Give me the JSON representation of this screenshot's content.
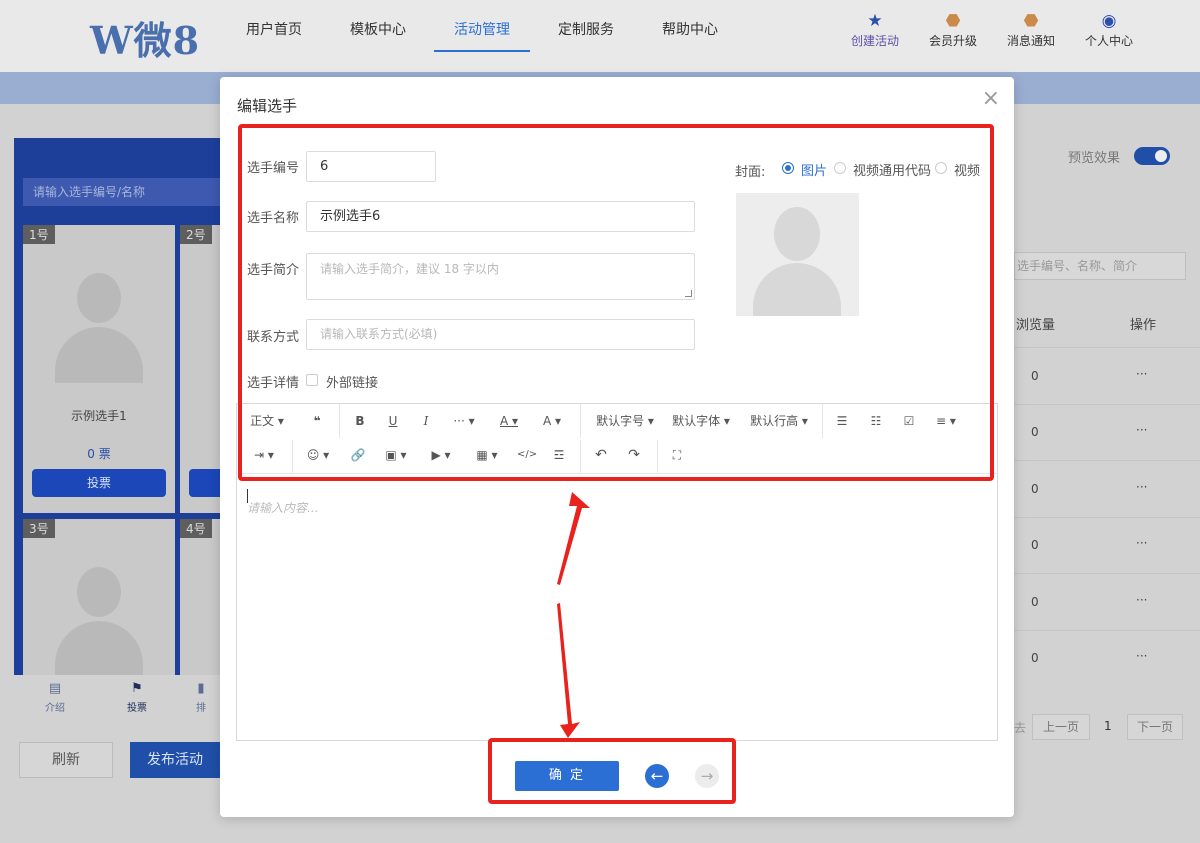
{
  "header": {
    "logo": "W微8",
    "nav": [
      {
        "label": "用户首页",
        "active": false
      },
      {
        "label": "模板中心",
        "active": false
      },
      {
        "label": "活动管理",
        "active": true
      },
      {
        "label": "定制服务",
        "active": false
      },
      {
        "label": "帮助中心",
        "active": false
      }
    ],
    "tools": [
      {
        "label": "创建活动",
        "icon": "star-icon"
      },
      {
        "label": "会员升级",
        "icon": "badge-icon"
      },
      {
        "label": "消息通知",
        "icon": "bell-icon"
      },
      {
        "label": "个人中心",
        "icon": "user-icon"
      }
    ]
  },
  "preview": {
    "search_placeholder": "请输入选手编号/名称",
    "cards": [
      {
        "num": "1号",
        "name": "示例选手1",
        "votes": "0 票",
        "vote_btn": "投票"
      },
      {
        "num": "2号"
      },
      {
        "num": "3号"
      },
      {
        "num": "4号"
      }
    ],
    "tabs": [
      {
        "label": "介绍",
        "icon": "doc-icon"
      },
      {
        "label": "投票",
        "icon": "flag-icon"
      },
      {
        "label": "排",
        "icon": "bar-chart-icon"
      }
    ],
    "refresh": "刷新",
    "publish": "发布活动"
  },
  "right_panel": {
    "preview_toggle_label": "预览效果",
    "preview_toggle_on": true,
    "search_placeholder": "选手编号、名称、简介",
    "col_views": "浏览量",
    "col_actions": "操作",
    "rows": [
      {
        "views": "0",
        "more": "···"
      },
      {
        "views": "0",
        "more": "···"
      },
      {
        "views": "0",
        "more": "···"
      },
      {
        "views": "0",
        "more": "···"
      },
      {
        "views": "0",
        "more": "···"
      },
      {
        "views": "0",
        "more": "···"
      }
    ],
    "pager": {
      "left_fragment": "去",
      "prev": "上一页",
      "page": "1",
      "next": "下一页"
    }
  },
  "modal": {
    "title": "编辑选手",
    "close_icon": "×",
    "fields": {
      "number_label": "选手编号",
      "number_value": "6",
      "name_label": "选手名称",
      "name_value": "示例选手6",
      "intro_label": "选手简介",
      "intro_placeholder": "请输入选手简介，建议 18 字以内",
      "contact_label": "联系方式",
      "contact_placeholder": "请输入联系方式(必填)",
      "detail_label": "选手详情",
      "external_link_label": "外部链接"
    },
    "cover": {
      "label": "封面:",
      "options": [
        {
          "label": "图片",
          "selected": true
        },
        {
          "label": "视频通用代码",
          "selected": false
        },
        {
          "label": "视频",
          "selected": false
        }
      ]
    },
    "toolbar": {
      "row1": [
        {
          "label": "正文 ▾",
          "icon": "paragraph-icon"
        },
        {
          "label": "❝",
          "icon": "quote-icon"
        },
        {
          "label": "B",
          "icon": "bold-icon"
        },
        {
          "label": "U",
          "icon": "underline-icon"
        },
        {
          "label": "I",
          "icon": "italic-icon"
        },
        {
          "label": "··· ▾",
          "icon": "more-icon"
        },
        {
          "label": "A ▾",
          "icon": "font-color-icon"
        },
        {
          "label": "A ▾",
          "icon": "bg-color-icon"
        },
        {
          "label": "默认字号 ▾",
          "icon": "font-size-icon"
        },
        {
          "label": "默认字体 ▾",
          "icon": "font-family-icon"
        },
        {
          "label": "默认行高 ▾",
          "icon": "line-height-icon"
        },
        {
          "label": "☰",
          "icon": "bullet-list-icon"
        },
        {
          "label": "☷",
          "icon": "numbered-list-icon"
        },
        {
          "label": "☑",
          "icon": "todo-icon"
        },
        {
          "label": "≡ ▾",
          "icon": "align-icon"
        }
      ],
      "row2": [
        {
          "label": "⇥ ▾",
          "icon": "indent-icon"
        },
        {
          "label": "☺ ▾",
          "icon": "emoji-icon"
        },
        {
          "label": "🔗",
          "icon": "link-icon"
        },
        {
          "label": "▣ ▾",
          "icon": "image-icon"
        },
        {
          "label": "▶ ▾",
          "icon": "video-icon"
        },
        {
          "label": "▦ ▾",
          "icon": "table-icon"
        },
        {
          "label": "</>",
          "icon": "code-icon"
        },
        {
          "label": "☲",
          "icon": "divider-icon"
        },
        {
          "label": "↶",
          "icon": "undo-icon"
        },
        {
          "label": "↷",
          "icon": "redo-icon"
        },
        {
          "label": "⛶",
          "icon": "fullscreen-icon"
        }
      ]
    },
    "editor_placeholder": "请输入内容...",
    "confirm": "确 定",
    "prev_icon": "←",
    "next_icon": "→"
  },
  "colors": {
    "accent": "#2b6fd4",
    "highlight": "#e8221c",
    "preview_bg": "#1d3f9a"
  }
}
